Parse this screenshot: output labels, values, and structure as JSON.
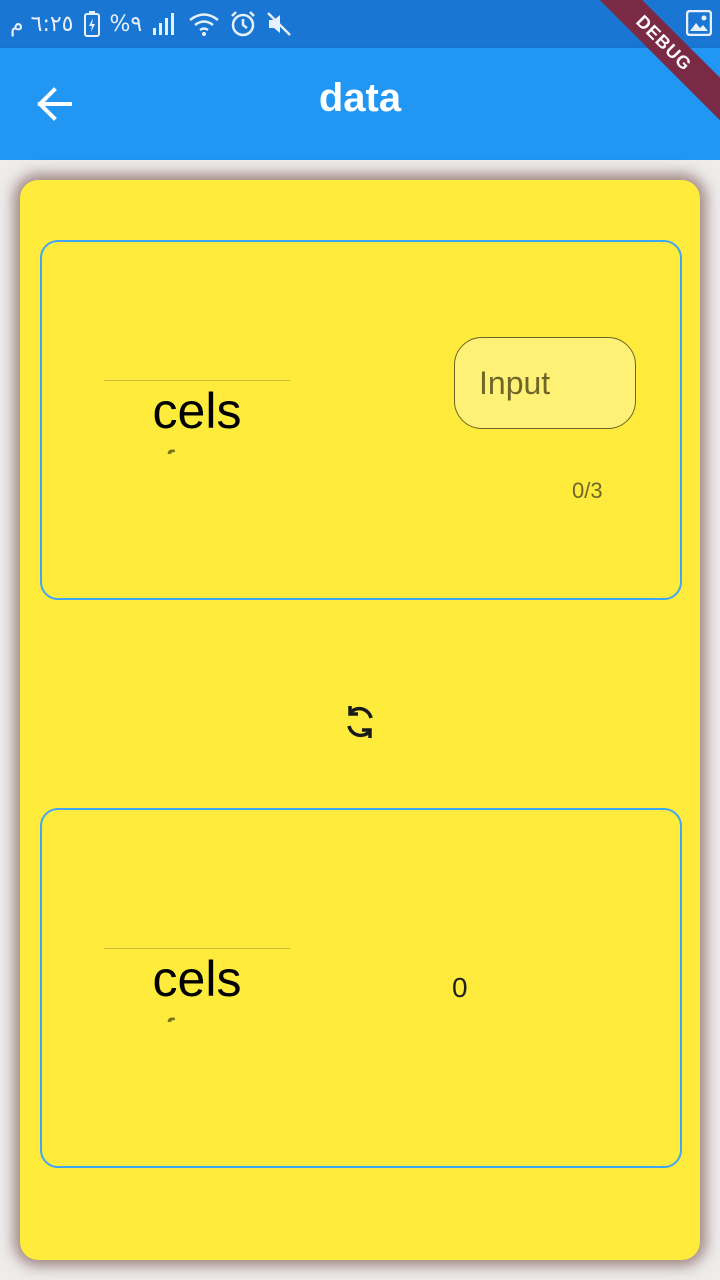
{
  "status_bar": {
    "time": "٦:٢٥ م",
    "battery_percent": "%٩"
  },
  "app_bar": {
    "title": "data",
    "debug_banner": "DEBUG"
  },
  "input_card": {
    "picker": {
      "selected": "cels",
      "next": "fenr"
    },
    "input_placeholder": "Input",
    "char_counter": "0/3"
  },
  "output_card": {
    "picker": {
      "selected": "cels",
      "next": "fenr"
    },
    "result_value": "0"
  },
  "icons": {
    "back": "arrow-left-icon",
    "swap": "refresh-icon"
  },
  "colors": {
    "status_bar": "#1976d2",
    "app_bar": "#2196f3",
    "card_background": "#ffeb3b",
    "box_border": "#42a5f5",
    "input_fill": "#fff176"
  }
}
